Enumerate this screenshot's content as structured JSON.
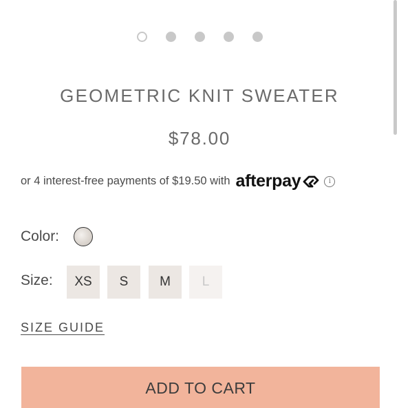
{
  "carousel": {
    "count": 5,
    "active_index": 0
  },
  "product": {
    "title": "GEOMETRIC KNIT SWEATER",
    "price": "$78.00"
  },
  "afterpay": {
    "text": "or 4 interest-free payments of $19.50 with",
    "logo_text": "afterpay",
    "info_icon": "info-icon"
  },
  "color": {
    "label": "Color:",
    "selected_swatch": "cream"
  },
  "size": {
    "label": "Size:",
    "options": [
      {
        "label": "XS",
        "available": true
      },
      {
        "label": "S",
        "available": true
      },
      {
        "label": "M",
        "available": true
      },
      {
        "label": "L",
        "available": false
      }
    ]
  },
  "size_guide": "SIZE GUIDE",
  "cart": {
    "button_label": "ADD TO CART",
    "accent_color": "#f2b49b"
  }
}
